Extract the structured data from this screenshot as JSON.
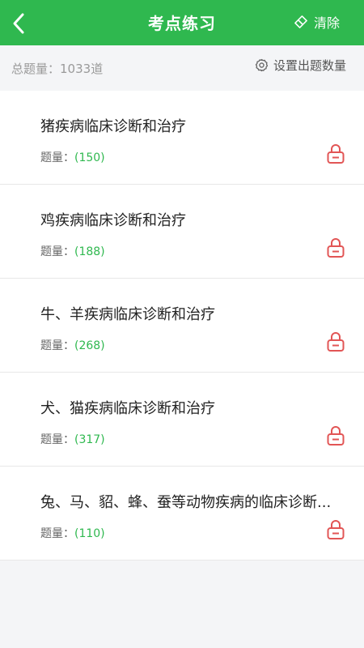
{
  "header": {
    "title": "考点练习",
    "clear_label": "清除"
  },
  "summary": {
    "total_label": "总题量：",
    "total_value": "1033道",
    "settings_label": "设置出题数量"
  },
  "items": [
    {
      "title": "猪疾病临床诊断和治疗",
      "count_label": "题量：",
      "count": "(150)"
    },
    {
      "title": "鸡疾病临床诊断和治疗",
      "count_label": "题量：",
      "count": "(188)"
    },
    {
      "title": "牛、羊疾病临床诊断和治疗",
      "count_label": "题量：",
      "count": "(268)"
    },
    {
      "title": "犬、猫疾病临床诊断和治疗",
      "count_label": "题量：",
      "count": "(317)"
    },
    {
      "title": "兔、马、貂、蜂、蚕等动物疾病的临床诊断...",
      "count_label": "题量：",
      "count": "(110)"
    }
  ],
  "colors": {
    "accent": "#2fb84f",
    "lock": "#e25555"
  },
  "icons": {
    "back": "chevron-left-icon",
    "clear": "eraser-icon",
    "settings": "gear-icon",
    "lock": "lock-icon"
  }
}
